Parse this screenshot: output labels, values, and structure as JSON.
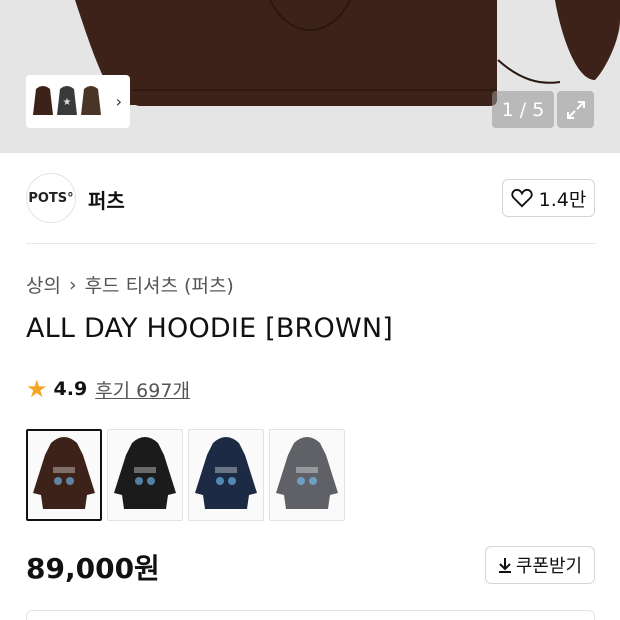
{
  "gallery": {
    "counter": "1 / 5",
    "colors": {
      "hoodie": "#3d2219",
      "background": "#e5e5e5"
    }
  },
  "brand": {
    "logo_text": "POTS°",
    "name": "퍼츠",
    "likes": "1.4만"
  },
  "breadcrumb": {
    "category": "상의",
    "subcategory": "후드 티셔츠 (퍼츠)"
  },
  "product": {
    "title": "ALL DAY HOODIE [BROWN]",
    "rating": "4.9",
    "reviews": "후기 697개",
    "price": "89,000원",
    "coupon_label": "쿠폰받기"
  },
  "variants": [
    {
      "name": "brown",
      "color": "#3d2219",
      "selected": true
    },
    {
      "name": "black",
      "color": "#1b1b1b",
      "selected": false
    },
    {
      "name": "navy",
      "color": "#1d2a44",
      "selected": false
    },
    {
      "name": "gray",
      "color": "#5f6166",
      "selected": false
    }
  ],
  "accent": {
    "star": "#f5a623"
  }
}
